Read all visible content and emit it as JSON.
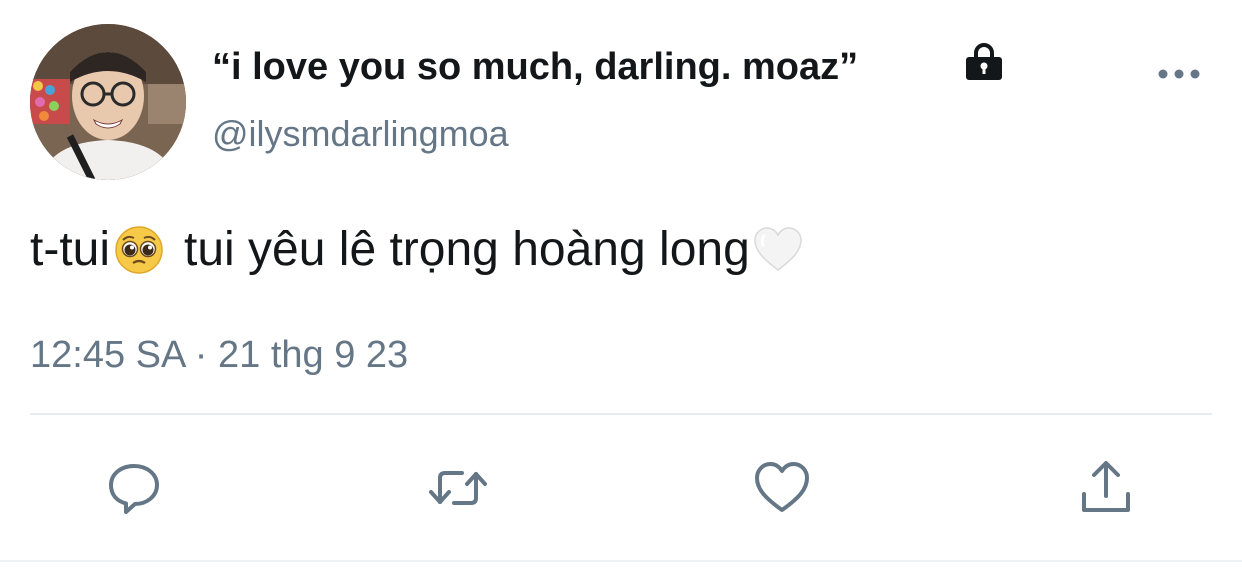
{
  "tweet": {
    "display_name": "“i love you so much, darling. moaz”",
    "handle": "@ilysmdarlingmoa",
    "protected": true,
    "text_before": "t-tui",
    "text_after": "tui yêu lê trọng hoàng long",
    "emojis": [
      "pleading-face-emoji",
      "white-heart-emoji"
    ],
    "timestamp": "12:45 SA · 21 thg 9 23"
  },
  "icons": {
    "lock": "lock-icon",
    "more": "more-icon",
    "reply": "reply-icon",
    "retweet": "retweet-icon",
    "like": "heart-icon",
    "share": "share-icon"
  },
  "colors": {
    "text_primary": "#14171a",
    "text_secondary": "#657786",
    "divider": "#e6ecf0",
    "action_icon": "#657786"
  }
}
